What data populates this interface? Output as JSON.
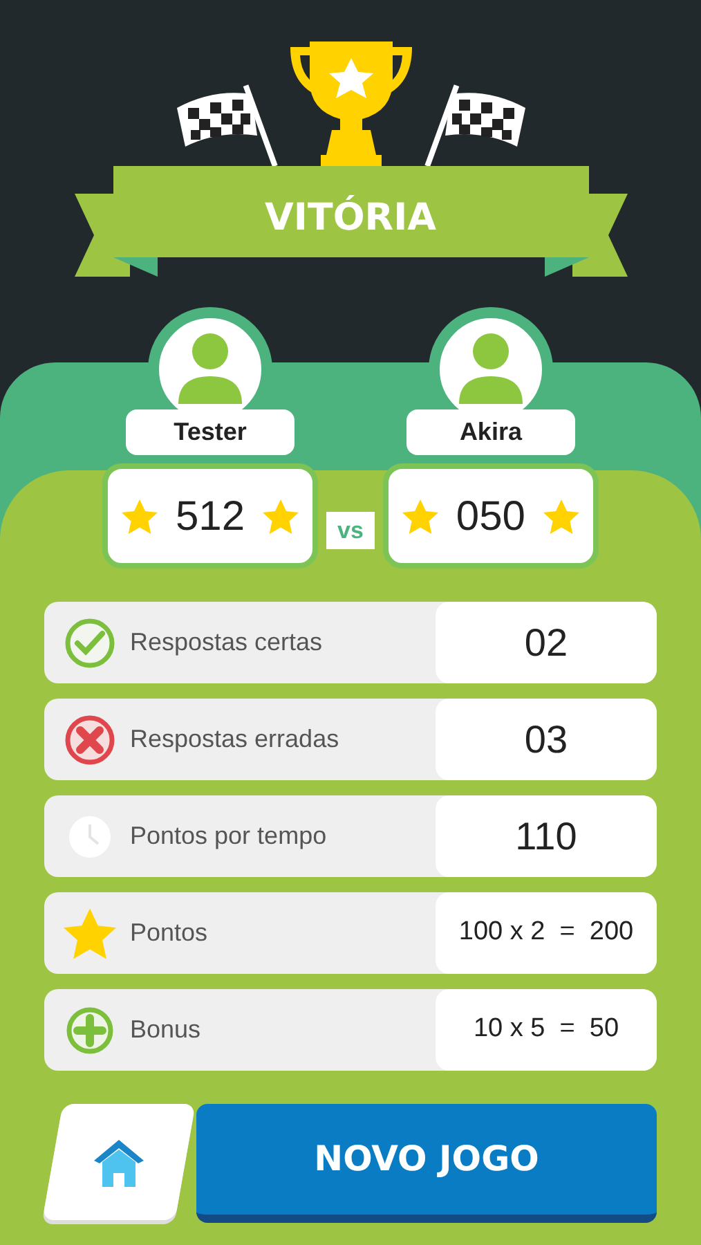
{
  "title": "VITÓRIA",
  "players": [
    {
      "name": "Tester",
      "score": "512"
    },
    {
      "name": "Akira",
      "score": "050"
    }
  ],
  "versus": "vs",
  "stats": [
    {
      "kind": "check",
      "label": "Respostas certas",
      "value": "02"
    },
    {
      "kind": "cross",
      "label": "Respostas erradas",
      "value": "03"
    },
    {
      "kind": "clock",
      "label": "Pontos por tempo",
      "value": "110"
    },
    {
      "kind": "star",
      "label": "Pontos",
      "value": "100 x 2  =  200"
    },
    {
      "kind": "plus",
      "label": "Bonus",
      "value": "10 x 5  =  50"
    }
  ],
  "new_game_button": {
    "label": "NOVO JOGO"
  }
}
